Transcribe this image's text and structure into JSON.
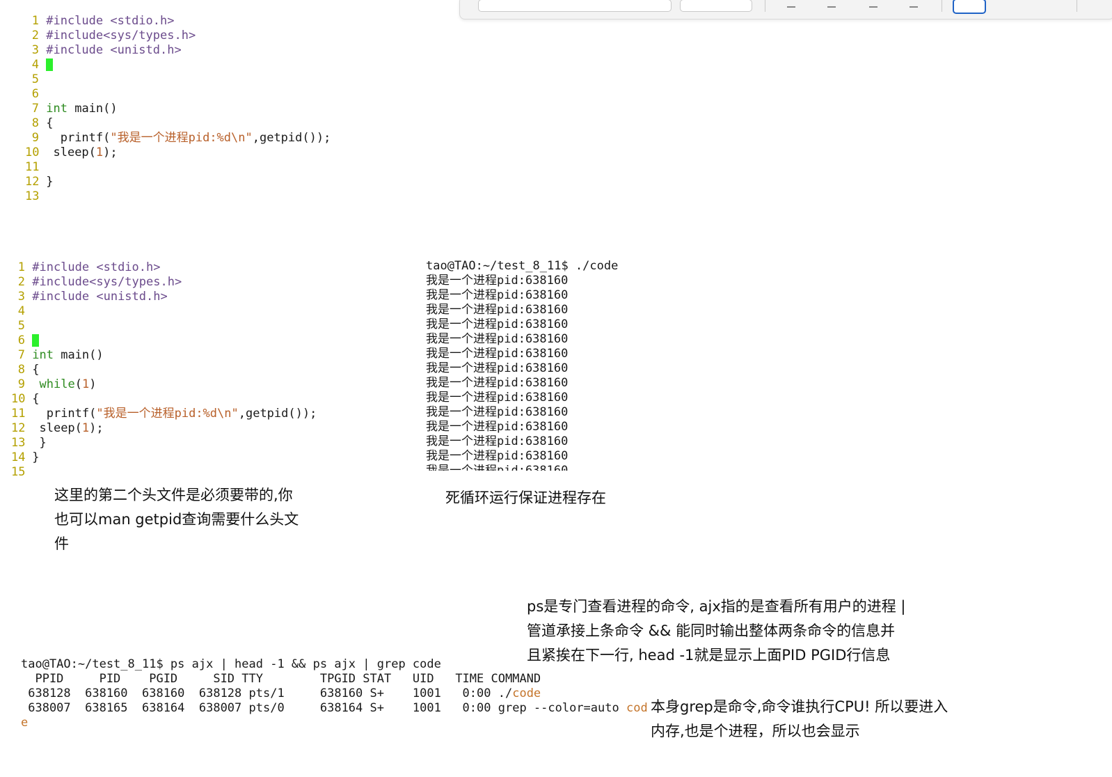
{
  "code1": {
    "lines": [
      {
        "n": "1",
        "parts": [
          {
            "c": "inc",
            "t": "#include <stdio.h>"
          }
        ]
      },
      {
        "n": "2",
        "parts": [
          {
            "c": "inc",
            "t": "#include<sys/types.h>"
          }
        ]
      },
      {
        "n": "3",
        "parts": [
          {
            "c": "inc",
            "t": "#include <unistd.h>"
          }
        ]
      },
      {
        "n": "4",
        "parts": [],
        "cursor": true
      },
      {
        "n": "5",
        "parts": []
      },
      {
        "n": "6",
        "parts": []
      },
      {
        "n": "7",
        "parts": [
          {
            "c": "kw",
            "t": "int"
          },
          {
            "c": "plain",
            "t": " main()"
          }
        ]
      },
      {
        "n": "8",
        "parts": [
          {
            "c": "plain",
            "t": "{"
          }
        ]
      },
      {
        "n": "9",
        "parts": [
          {
            "c": "plain",
            "t": "  printf("
          },
          {
            "c": "str",
            "t": "\"我是一个进程pid:%d\\n\""
          },
          {
            "c": "plain",
            "t": ",getpid());"
          }
        ]
      },
      {
        "n": "10",
        "parts": [
          {
            "c": "plain",
            "t": " sleep("
          },
          {
            "c": "num",
            "t": "1"
          },
          {
            "c": "plain",
            "t": ");"
          }
        ]
      },
      {
        "n": "11",
        "parts": []
      },
      {
        "n": "12",
        "parts": [
          {
            "c": "plain",
            "t": "}"
          }
        ]
      },
      {
        "n": "13",
        "parts": []
      }
    ]
  },
  "code2": {
    "lines": [
      {
        "n": "1",
        "parts": [
          {
            "c": "inc",
            "t": "#include <stdio.h>"
          }
        ]
      },
      {
        "n": "2",
        "parts": [
          {
            "c": "inc",
            "t": "#include<sys/types.h>"
          }
        ]
      },
      {
        "n": "3",
        "parts": [
          {
            "c": "inc",
            "t": "#include <unistd.h>"
          }
        ]
      },
      {
        "n": "4",
        "parts": []
      },
      {
        "n": "5",
        "parts": []
      },
      {
        "n": "6",
        "parts": [],
        "cursor": true
      },
      {
        "n": "7",
        "parts": [
          {
            "c": "kw",
            "t": "int"
          },
          {
            "c": "plain",
            "t": " main()"
          }
        ]
      },
      {
        "n": "8",
        "parts": [
          {
            "c": "plain",
            "t": "{"
          }
        ]
      },
      {
        "n": "9",
        "parts": [
          {
            "c": "plain",
            "t": " "
          },
          {
            "c": "kw",
            "t": "while"
          },
          {
            "c": "plain",
            "t": "("
          },
          {
            "c": "num",
            "t": "1"
          },
          {
            "c": "plain",
            "t": ")"
          }
        ]
      },
      {
        "n": "10",
        "parts": [
          {
            "c": "plain",
            "t": "{"
          }
        ]
      },
      {
        "n": "11",
        "parts": [
          {
            "c": "plain",
            "t": "  printf("
          },
          {
            "c": "str",
            "t": "\"我是一个进程pid:%d\\n\""
          },
          {
            "c": "plain",
            "t": ",getpid());"
          }
        ]
      },
      {
        "n": "12",
        "parts": [
          {
            "c": "plain",
            "t": " sleep("
          },
          {
            "c": "num",
            "t": "1"
          },
          {
            "c": "plain",
            "t": ");"
          }
        ]
      },
      {
        "n": "13",
        "parts": [
          {
            "c": "plain",
            "t": " }"
          }
        ]
      },
      {
        "n": "14",
        "parts": [
          {
            "c": "plain",
            "t": "}"
          }
        ]
      },
      {
        "n": "15",
        "parts": []
      }
    ]
  },
  "terminal1": {
    "prompt": "tao@TAO:~/test_8_11$ ./code",
    "output_line": "我是一个进程pid:638160",
    "output_count": 14
  },
  "terminal2": {
    "prompt": "tao@TAO:~/test_8_11$ ps ajx | head -1 && ps ajx | grep code",
    "header": "  PPID     PID    PGID     SID TTY        TPGID STAT   UID   TIME COMMAND",
    "row1_prefix": " 638128  638160  638160  638128 pts/1     638160 S+    1001   0:00 ./",
    "row1_hl": "code",
    "row2_prefix": " 638007  638165  638164  638007 pts/0     638164 S+    1001   0:00 grep --color=auto ",
    "row2_hl": "cod",
    "row3_hl": "e"
  },
  "notes": {
    "header_note": [
      "这里的第二个头文件是必须要带的,你",
      "也可以man getpid查询需要什么头文",
      "件"
    ],
    "loop_note": "死循环运行保证进程存在",
    "ps_note": [
      "ps是专门查看进程的命令, ajx指的是查看所有用户的进程 |",
      "管道承接上条命令 && 能同时输出整体两条命令的信息并",
      "且紧挨在下一行, head -1就是显示上面PID PGID行信息"
    ],
    "grep_note": [
      "本身grep是命令,命令谁执行CPU! 所以要进入",
      "内存,也是个进程，所以也会显示"
    ]
  }
}
